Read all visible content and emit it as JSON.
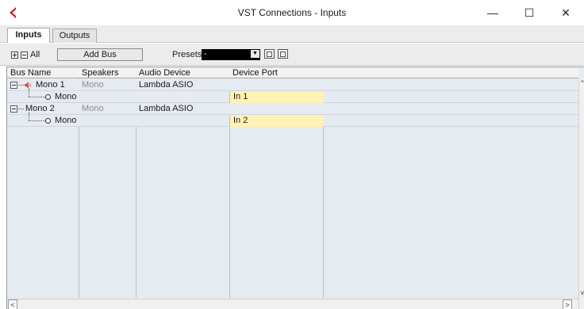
{
  "window": {
    "title": "VST Connections - Inputs",
    "minimize_glyph": "—",
    "maximize_glyph": "☐",
    "close_glyph": "✕"
  },
  "tabs": [
    {
      "label": "Inputs",
      "active": true
    },
    {
      "label": "Outputs",
      "active": false
    }
  ],
  "toolbar": {
    "all_label": "All",
    "add_bus_label": "Add Bus",
    "presets_label": "Presets",
    "presets_value": "-"
  },
  "grid": {
    "columns": [
      "Bus Name",
      "Speakers",
      "Audio Device",
      "Device Port"
    ],
    "rows": [
      {
        "bus_name": "Mono 1",
        "speakers": "Mono",
        "audio_device": "Lambda ASIO",
        "device_port": "",
        "level": 0,
        "has_speaker_icon": true
      },
      {
        "bus_name": "Mono",
        "speakers": "",
        "audio_device": "",
        "device_port": "In 1",
        "level": 1
      },
      {
        "bus_name": "Mono 2",
        "speakers": "Mono",
        "audio_device": "Lambda ASIO",
        "device_port": "",
        "level": 0,
        "has_speaker_icon": false
      },
      {
        "bus_name": "Mono",
        "speakers": "",
        "audio_device": "",
        "device_port": "In 2",
        "level": 1
      }
    ]
  },
  "scrollbars": {
    "up_glyph": "^",
    "down_glyph": "v",
    "left_glyph": "<",
    "right_glyph": ">"
  },
  "colors": {
    "accent_logo": "#c4202a",
    "grid_background": "#e6ebf2",
    "port_highlight": "#fff2b3",
    "speaker_icon": "#d9534f"
  }
}
